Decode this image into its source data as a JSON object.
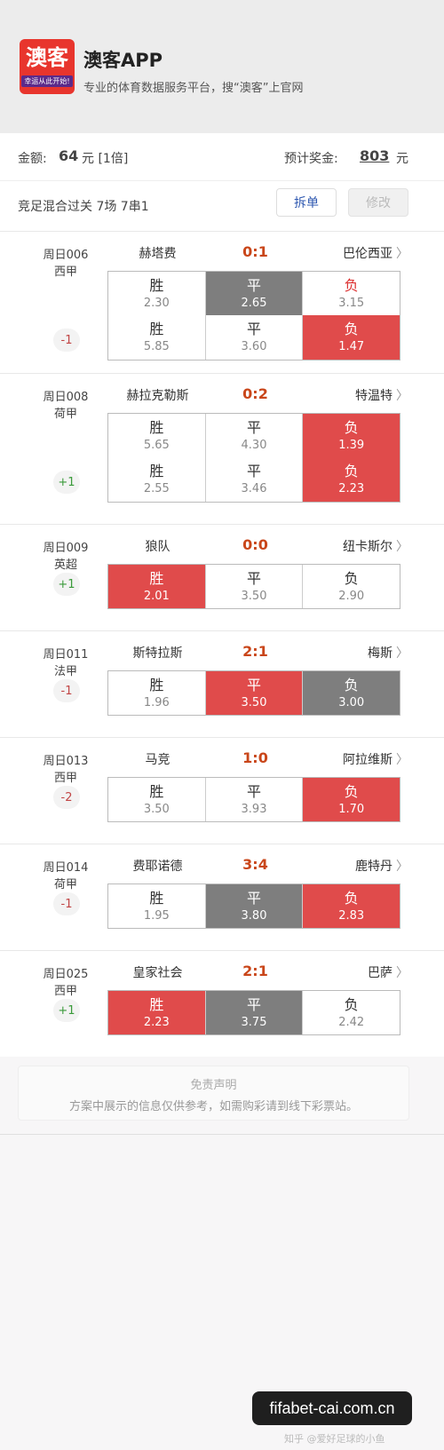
{
  "header": {
    "logo_text": "澳客",
    "logo_sub": "幸运从此开始!",
    "app_name": "澳客APP",
    "slogan": "专业的体育数据服务平台，搜“澳客”上官网"
  },
  "summary": {
    "amount_label": "金额:",
    "amount_value": "64",
    "amount_unit": "元 [1倍]",
    "prize_label": "预计奖金:",
    "prize_value": "803",
    "prize_unit": "元"
  },
  "bet": {
    "type": "竞足混合过关 7场 7串1",
    "split_label": "拆单",
    "edit_label": "修改"
  },
  "colors": {
    "red": "#e04b4b",
    "gray": "#7e7e7e",
    "score": "#c9461a"
  },
  "matches": [
    {
      "id": "周日006",
      "league": "西甲",
      "home": "赫塔费",
      "score": "0:1",
      "away": "巴伦西亚",
      "handicap": "-1",
      "rows": [
        [
          {
            "l": "胜",
            "v": "2.30"
          },
          {
            "l": "平",
            "v": "2.65"
          },
          {
            "l": "负",
            "v": "3.15"
          }
        ],
        [
          {
            "l": "胜",
            "v": "5.85"
          },
          {
            "l": "平",
            "v": "3.60"
          },
          {
            "l": "负",
            "v": "1.47"
          }
        ]
      ]
    },
    {
      "id": "周日008",
      "league": "荷甲",
      "home": "赫拉克勒斯",
      "score": "0:2",
      "away": "特温特",
      "handicap": "+1",
      "rows": [
        [
          {
            "l": "胜",
            "v": "5.65"
          },
          {
            "l": "平",
            "v": "4.30"
          },
          {
            "l": "负",
            "v": "1.39"
          }
        ],
        [
          {
            "l": "胜",
            "v": "2.55"
          },
          {
            "l": "平",
            "v": "3.46"
          },
          {
            "l": "负",
            "v": "2.23"
          }
        ]
      ]
    },
    {
      "id": "周日009",
      "league": "英超",
      "home": "狼队",
      "score": "0:0",
      "away": "纽卡斯尔",
      "handicap": "+1",
      "rows": [
        [
          {
            "l": "胜",
            "v": "2.01"
          },
          {
            "l": "平",
            "v": "3.50"
          },
          {
            "l": "负",
            "v": "2.90"
          }
        ]
      ]
    },
    {
      "id": "周日011",
      "league": "法甲",
      "home": "斯特拉斯",
      "score": "2:1",
      "away": "梅斯",
      "handicap": "-1",
      "rows": [
        [
          {
            "l": "胜",
            "v": "1.96"
          },
          {
            "l": "平",
            "v": "3.50"
          },
          {
            "l": "负",
            "v": "3.00"
          }
        ]
      ]
    },
    {
      "id": "周日013",
      "league": "西甲",
      "home": "马竞",
      "score": "1:0",
      "away": "阿拉维斯",
      "handicap": "-2",
      "rows": [
        [
          {
            "l": "胜",
            "v": "3.50"
          },
          {
            "l": "平",
            "v": "3.93"
          },
          {
            "l": "负",
            "v": "1.70"
          }
        ]
      ]
    },
    {
      "id": "周日014",
      "league": "荷甲",
      "home": "费耶诺德",
      "score": "3:4",
      "away": "鹿特丹",
      "handicap": "-1",
      "rows": [
        [
          {
            "l": "胜",
            "v": "1.95"
          },
          {
            "l": "平",
            "v": "3.80"
          },
          {
            "l": "负",
            "v": "2.83"
          }
        ]
      ]
    },
    {
      "id": "周日025",
      "league": "西甲",
      "home": "皇家社会",
      "score": "2:1",
      "away": "巴萨",
      "handicap": "+1",
      "rows": [
        [
          {
            "l": "胜",
            "v": "2.23"
          },
          {
            "l": "平",
            "v": "3.75"
          },
          {
            "l": "负",
            "v": "2.42"
          }
        ]
      ]
    }
  ],
  "disclaimer": {
    "title": "免责声明",
    "text": "方案中展示的信息仅供参考，如需购彩请到线下彩票站。"
  },
  "watermark": "fifabet-cai.com.cn",
  "zhihu": "知乎 @爱好足球的小鱼"
}
